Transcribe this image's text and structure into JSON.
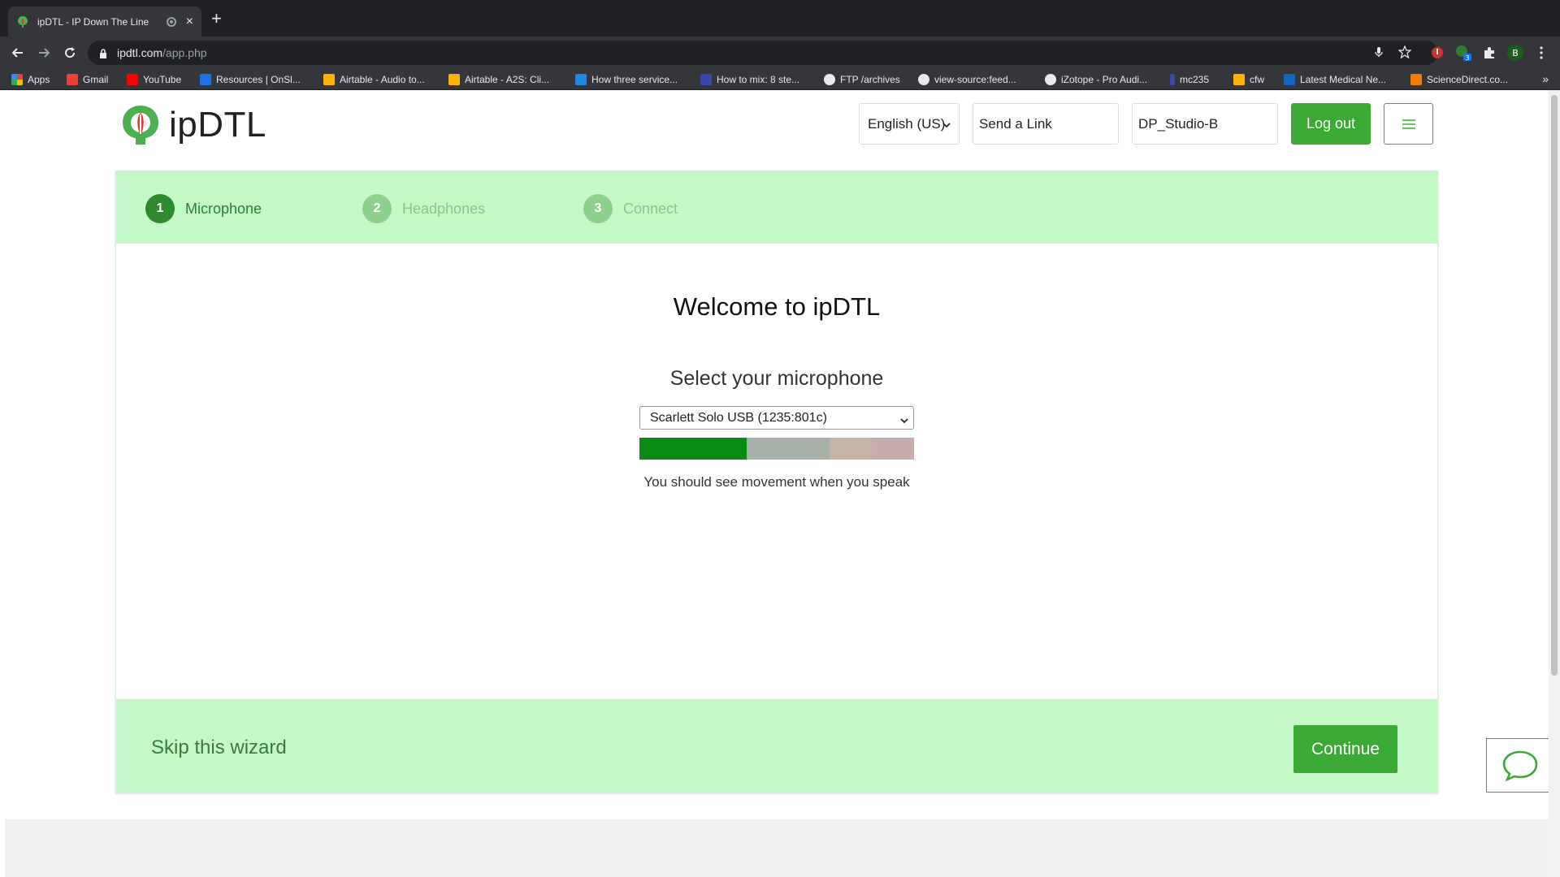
{
  "browser": {
    "tab_title": "ipDTL - IP Down The Line",
    "url_host": "ipdtl.com",
    "url_path": "/app.php",
    "profile_initial": "B",
    "extension_badge": "3",
    "bookmarks": [
      {
        "label": "Apps",
        "color": "#e8453c"
      },
      {
        "label": "Gmail",
        "color": "#ea4335"
      },
      {
        "label": "YouTube",
        "color": "#ff0000"
      },
      {
        "label": "Resources | OnSl...",
        "color": "#1a73e8"
      },
      {
        "label": "Airtable - Audio to...",
        "color": "#fcb400"
      },
      {
        "label": "Airtable - A2S: Cli...",
        "color": "#fcb400"
      },
      {
        "label": "How three service...",
        "color": "#1e88e5"
      },
      {
        "label": "How to mix: 8 ste...",
        "color": "#3949ab"
      },
      {
        "label": "FTP /archives",
        "color": "#e8eaed"
      },
      {
        "label": "view-source:feed...",
        "color": "#e8eaed"
      },
      {
        "label": "iZotope - Pro Audi...",
        "color": "#e8eaed"
      },
      {
        "label": "mc235",
        "color": "#3949ab"
      },
      {
        "label": "cfw",
        "color": "#fcb400"
      },
      {
        "label": "Latest Medical Ne...",
        "color": "#1565c0"
      },
      {
        "label": "ScienceDirect.co...",
        "color": "#f57c00"
      }
    ],
    "bookmarks_more": "»"
  },
  "header": {
    "logo_text": "ipDTL",
    "language": "English (US)",
    "send_link_placeholder": "Send a Link",
    "username_value": "DP_Studio-B",
    "logout_label": "Log out"
  },
  "wizard": {
    "steps": [
      {
        "number": "1",
        "label": "Microphone",
        "active": true
      },
      {
        "number": "2",
        "label": "Headphones",
        "active": false
      },
      {
        "number": "3",
        "label": "Connect",
        "active": false
      }
    ],
    "welcome_title": "Welcome to ipDTL",
    "select_heading": "Select your microphone",
    "selected_microphone": "Scarlett Solo USB (1235:801c)",
    "mic_level_fraction": 0.39,
    "meter_hint": "You should see movement when you speak",
    "skip_label": "Skip this wizard",
    "continue_label": "Continue"
  },
  "colors": {
    "accent_green": "#3aaa35",
    "light_green_band": "#c4f8c6",
    "meter_active": "#0b8a16",
    "meter_idle": "#a8b2a8",
    "meter_warn": "#c6b4a6",
    "meter_peak": "#c6aeae"
  }
}
